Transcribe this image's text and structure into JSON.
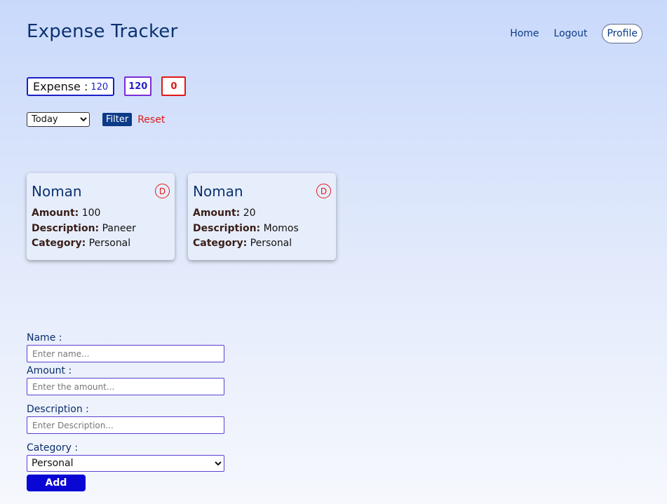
{
  "header": {
    "title": "Expense Tracker",
    "nav": {
      "home": "Home",
      "logout": "Logout",
      "profile": "Profile"
    }
  },
  "summary": {
    "expense_label": "Expense :",
    "expense_value": "120",
    "total_box": "120",
    "zero_box": "0"
  },
  "filter": {
    "selected": "Today",
    "button_label": "Filter",
    "reset_label": "Reset"
  },
  "cards": [
    {
      "name": "Noman",
      "delete_label": "D",
      "amount_label": "Amount:",
      "amount": "100",
      "description_label": "Description:",
      "description": "Paneer",
      "category_label": "Category:",
      "category": "Personal"
    },
    {
      "name": "Noman",
      "delete_label": "D",
      "amount_label": "Amount:",
      "amount": "20",
      "description_label": "Description:",
      "description": "Momos",
      "category_label": "Category:",
      "category": "Personal"
    }
  ],
  "form": {
    "name_label": "Name :",
    "name_placeholder": "Enter name...",
    "amount_label": "Amount :",
    "amount_placeholder": "Enter the amount...",
    "description_label": "Description :",
    "description_placeholder": "Enter Description...",
    "category_label": "Category :",
    "category_selected": "Personal",
    "add_label": "Add"
  },
  "colors": {
    "brand_blue": "#0b3a86",
    "accent_red": "#e01818",
    "accent_purple": "#7b2cd6",
    "button_blue": "#0a06d4"
  }
}
